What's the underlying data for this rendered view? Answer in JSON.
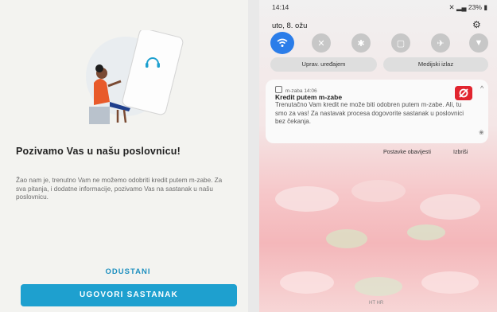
{
  "left_screen": {
    "title": "Pozivamo Vas u našu poslovnicu!",
    "body": "Žao nam je, trenutno Vam ne možemo odobriti kredit putem m-zabe. Za sva pitanja, i dodatne informacije, pozivamo Vas na sastanak u našu poslovnicu.",
    "cancel_label": "ODUSTANI",
    "primary_label": "UGOVORI SASTANAK",
    "accent_color": "#1ea0cf",
    "illustration_icon": "headset-icon"
  },
  "right_screen": {
    "status": {
      "time": "14:14",
      "battery": "23%"
    },
    "date": "uto, 8. ožu",
    "quick_settings": [
      {
        "icon": "wifi-icon",
        "active": true
      },
      {
        "icon": "sound-off-icon",
        "active": false
      },
      {
        "icon": "bluetooth-icon",
        "active": false
      },
      {
        "icon": "rotate-lock-icon",
        "active": false
      },
      {
        "icon": "airplane-icon",
        "active": false
      },
      {
        "icon": "flashlight-icon",
        "active": false
      }
    ],
    "device_control_label": "Uprav. uređajem",
    "media_output_label": "Medijski izlaz",
    "notification": {
      "app_name": "m-zaba",
      "time": "14:06",
      "title": "Kredit putem m-zabe",
      "text": "Trenutačno Vam kredit ne može biti odobren putem m-zabe. Ali, tu smo za vas! Za nastavak procesa dogovorite sastanak u poslovnici bez čekanja."
    },
    "notification_settings_label": "Postavke obavijesti",
    "clear_label": "Izbriši",
    "carrier": "HT HR"
  }
}
